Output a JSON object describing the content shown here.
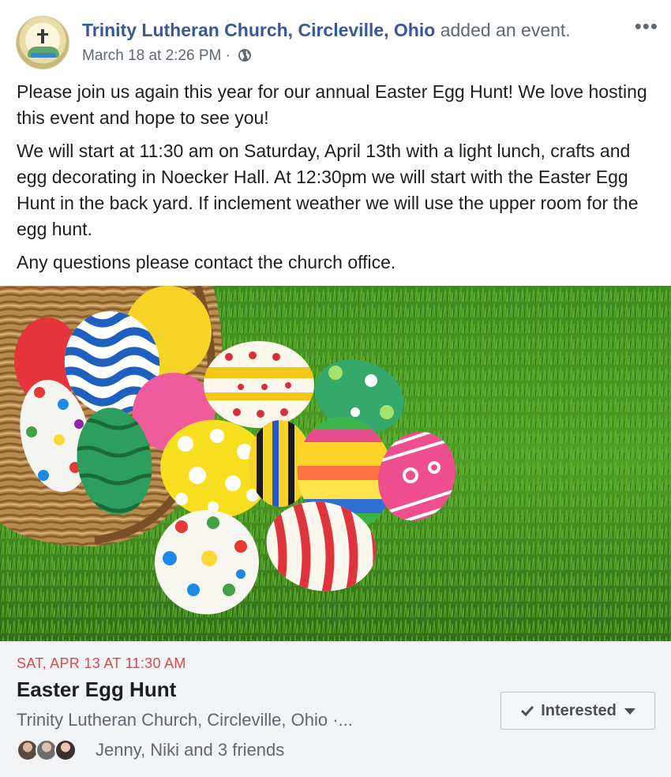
{
  "post": {
    "page_name": "Trinity Lutheran Church, Circleville, Ohio",
    "action": "added an event.",
    "timestamp": "March 18 at 2:26 PM",
    "meta_separator": "·",
    "audience_icon": "globe-icon",
    "more_label": "•••",
    "paragraphs": [
      "Please join us again this year for our annual Easter Egg Hunt! We love hosting this event and hope to see you!",
      "We will start at 11:30 am on Saturday, April 13th with a light lunch, crafts and egg decorating in Noecker Hall. At 12:30pm we will start with the Easter Egg Hunt in the back yard. If inclement weather we will use the upper room for the egg hunt.",
      "Any questions please contact the church office."
    ]
  },
  "event": {
    "date": "SAT, APR 13 AT 11:30 AM",
    "title": "Easter Egg Hunt",
    "location": "Trinity Lutheran Church, Circleville, Ohio ·...",
    "friends_text": "Jenny, Niki and 3 friends",
    "interested_label": "Interested"
  },
  "colors": {
    "link": "#385898",
    "date_red": "#e0484e",
    "card_bg": "#f2f3f5",
    "secondary_text": "#606770"
  }
}
